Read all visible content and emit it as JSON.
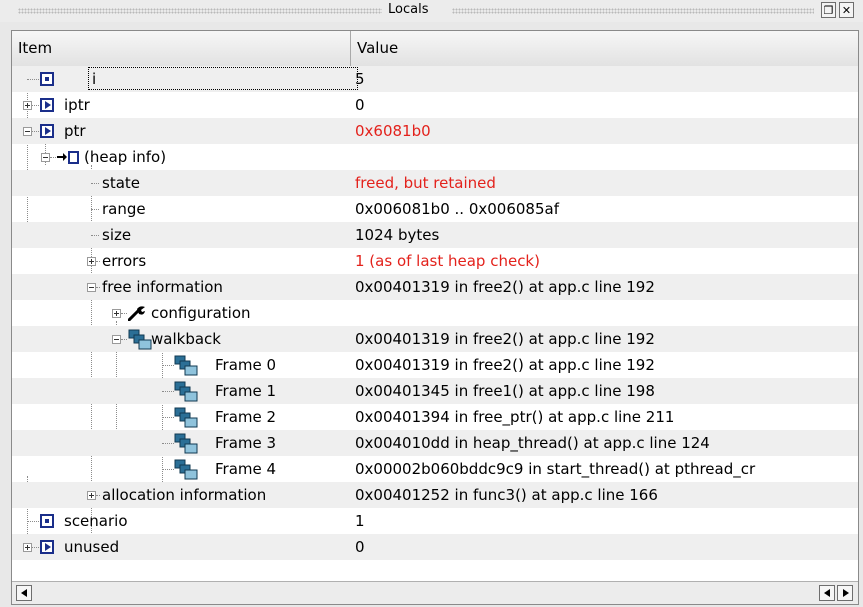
{
  "window": {
    "title": "Locals",
    "float_button_glyph": "❐",
    "close_button_glyph": "✕"
  },
  "columns": {
    "item": "Item",
    "value": "Value"
  },
  "colors": {
    "error_text": "#e3221c",
    "icon_blue": "#1a2e8a",
    "walkback_icon": "#2b6f96"
  },
  "rows": [
    {
      "label": "i",
      "value": "5",
      "icon": "variable-icon",
      "expander": "none",
      "red": false
    },
    {
      "label": "iptr",
      "value": "0",
      "icon": "pointer-icon",
      "expander": "plus",
      "red": false
    },
    {
      "label": "ptr",
      "value": "0x6081b0",
      "icon": "pointer-icon",
      "expander": "minus",
      "red": true
    },
    {
      "label": "(heap info)",
      "value": "",
      "icon": "heap-info-icon",
      "expander": "minus",
      "red": false
    },
    {
      "label": "state",
      "value": "freed, but retained",
      "icon": "",
      "expander": "none",
      "red": true
    },
    {
      "label": "range",
      "value": "0x006081b0 .. 0x006085af",
      "icon": "",
      "expander": "none",
      "red": false
    },
    {
      "label": "size",
      "value": "1024 bytes",
      "icon": "",
      "expander": "none",
      "red": false
    },
    {
      "label": "errors",
      "value": "1 (as of last heap check)",
      "icon": "",
      "expander": "plus",
      "red": true
    },
    {
      "label": "free information",
      "value": "0x00401319 in free2() at app.c line 192",
      "icon": "",
      "expander": "minus",
      "red": false
    },
    {
      "label": "configuration",
      "value": "",
      "icon": "wrench-icon",
      "expander": "plus",
      "red": false
    },
    {
      "label": "walkback",
      "value": "0x00401319 in free2() at app.c line 192",
      "icon": "stack-frames-icon",
      "expander": "minus",
      "red": false
    },
    {
      "label": "Frame 0",
      "value": "0x00401319 in free2() at app.c line 192",
      "icon": "stack-frames-icon",
      "expander": "none",
      "red": false
    },
    {
      "label": "Frame 1",
      "value": "0x00401345 in free1() at app.c line 198",
      "icon": "stack-frames-icon",
      "expander": "none",
      "red": false
    },
    {
      "label": "Frame 2",
      "value": "0x00401394 in free_ptr() at app.c line 211",
      "icon": "stack-frames-icon",
      "expander": "none",
      "red": false
    },
    {
      "label": "Frame 3",
      "value": "0x004010dd in heap_thread() at app.c line 124",
      "icon": "stack-frames-icon",
      "expander": "none",
      "red": false
    },
    {
      "label": "Frame 4",
      "value": "0x00002b060bddc9c9 in start_thread() at pthread_cr",
      "icon": "stack-frames-icon",
      "expander": "none",
      "red": false
    },
    {
      "label": "allocation information",
      "value": "0x00401252 in func3() at app.c line 166",
      "icon": "",
      "expander": "plus",
      "red": false
    },
    {
      "label": "scenario",
      "value": "1",
      "icon": "variable-icon",
      "expander": "none",
      "red": false
    },
    {
      "label": "unused",
      "value": "0",
      "icon": "pointer-icon",
      "expander": "plus",
      "red": false
    }
  ]
}
